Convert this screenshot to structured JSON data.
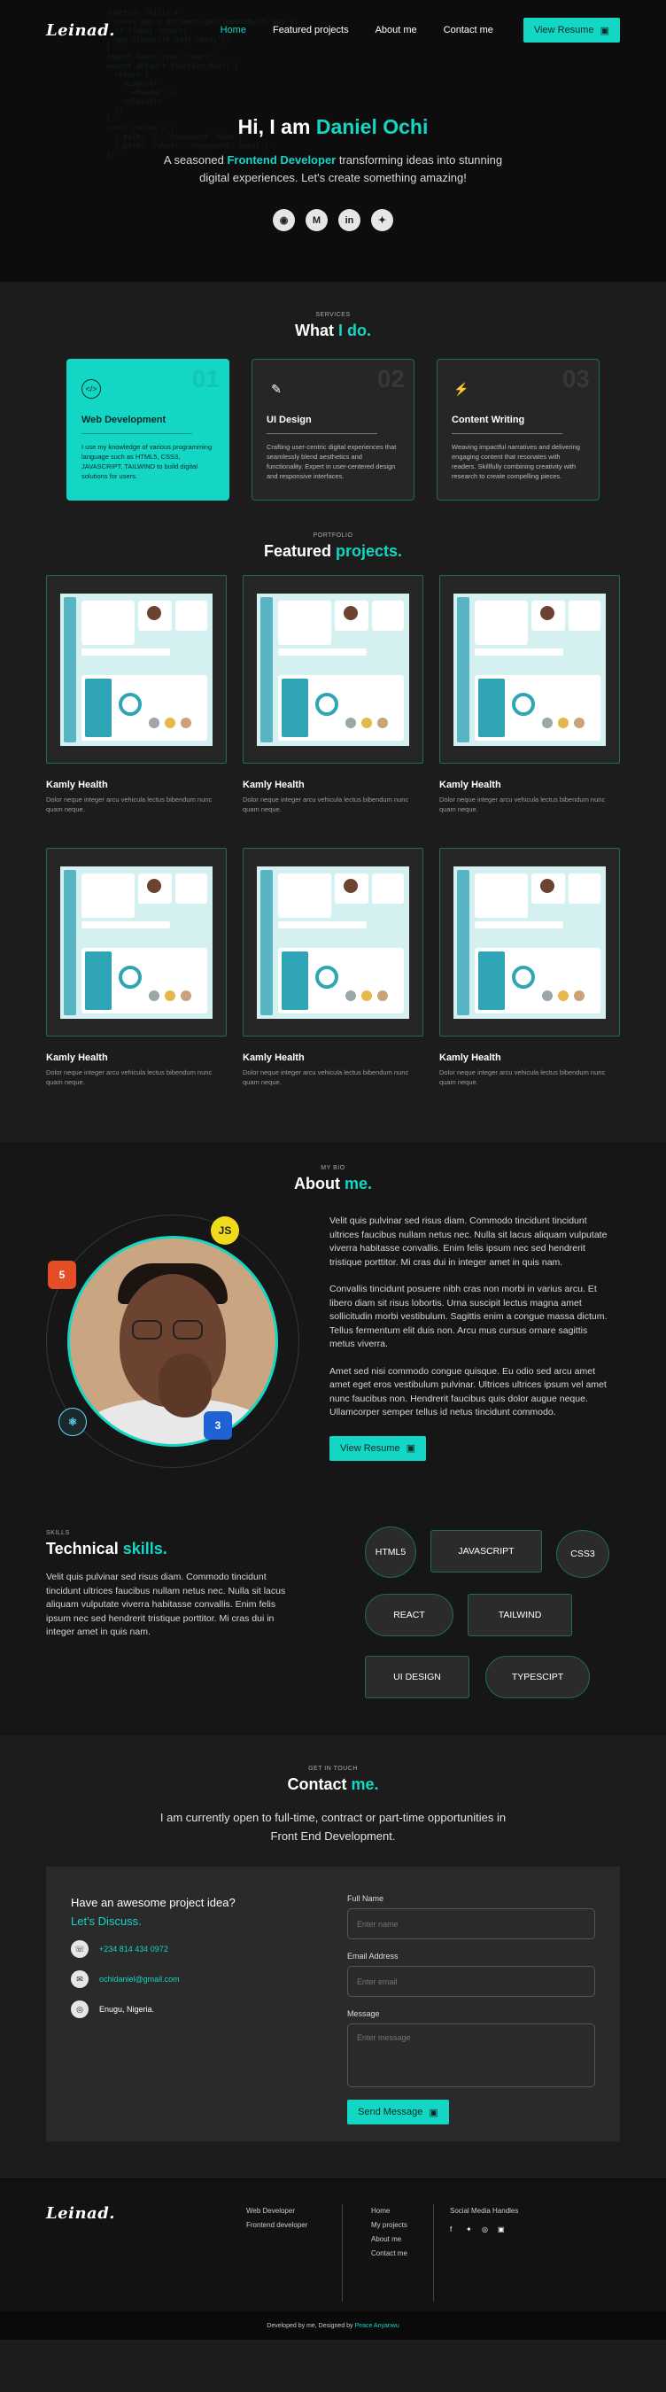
{
  "nav": {
    "logo": "Leinad.",
    "links": [
      "Home",
      "Featured projects",
      "About me",
      "Contact me"
    ],
    "resume_label": "View Resume"
  },
  "hero": {
    "greeting": "Hi, I am ",
    "name": "Daniel Ochi",
    "sub_pre": "A seasoned ",
    "role": "Frontend Developer",
    "sub_post": " transforming ideas into stunning",
    "sub_line2": "digital experiences. Let's create something amazing!",
    "socials": [
      "github-icon",
      "mail-icon",
      "linkedin-icon",
      "twitter-icon"
    ]
  },
  "services": {
    "label": "SERVICES",
    "title_pre": "What ",
    "title_accent": "I do",
    "items": [
      {
        "num": "01",
        "title": "Web Development",
        "desc": "I use my knowledge of various programming language such as HTML5, CSS3, JAVASCRIPT, TAILWIND to build digital solutions for users."
      },
      {
        "num": "02",
        "title": "UI Design",
        "desc": "Crafting user-centric digital experiences that seamlessly blend aesthetics and functionality. Expert in user-centered design and responsive interfaces."
      },
      {
        "num": "03",
        "title": "Content Writing",
        "desc": "Weaving impactful narratives and delivering engaging content that resonates with readers. Skillfully combining creativity with research to create compelling pieces."
      }
    ]
  },
  "projects": {
    "label": "PORTFOLIO",
    "title_pre": "Featured ",
    "title_accent": "projects",
    "items": [
      {
        "title": "Kamly Health",
        "desc": "Dolor neque integer arcu vehicula lectus bibendum nunc quam neque."
      },
      {
        "title": "Kamly Health",
        "desc": "Dolor neque integer arcu vehicula lectus bibendum nunc quam neque."
      },
      {
        "title": "Kamly Health",
        "desc": "Dolor neque integer arcu vehicula lectus bibendum nunc quam neque."
      },
      {
        "title": "Kamly Health",
        "desc": "Dolor neque integer arcu vehicula lectus bibendum nunc quam neque."
      },
      {
        "title": "Kamly Health",
        "desc": "Dolor neque integer arcu vehicula lectus bibendum nunc quam neque."
      },
      {
        "title": "Kamly Health",
        "desc": "Dolor neque integer arcu vehicula lectus bibendum nunc quam neque."
      }
    ]
  },
  "about": {
    "label": "MY BIO",
    "title_pre": "About ",
    "title_accent": "me",
    "paragraphs": [
      "Velit quis pulvinar sed risus diam. Commodo tincidunt tincidunt ultrices faucibus nullam netus nec. Nulla sit lacus aliquam vulputate viverra habitasse convallis. Enim felis ipsum nec sed hendrerit tristique porttitor. Mi cras dui in integer amet in quis nam.",
      "Convallis tincidunt posuere nibh cras non morbi in varius arcu. Et libero diam sit risus lobortis. Urna suscipit lectus magna amet sollicitudin morbi vestibulum. Sagittis enim a congue massa dictum. Tellus fermentum elit duis non. Arcu mus cursus ornare sagittis metus viverra.",
      "Amet sed nisi commodo congue quisque. Eu odio sed arcu amet amet eget eros vestibulum pulvinar. Ultrices ultrices ipsum vel amet nunc faucibus non. Hendrerit faucibus quis dolor augue neque. Ullamcorper semper tellus id netus tincidunt commodo."
    ],
    "resume_label": "View Resume",
    "badges": {
      "js": "JS",
      "html": "5",
      "css": "3",
      "react": "⚛"
    }
  },
  "skills": {
    "label": "SKILLS",
    "title_pre": "Technical ",
    "title_accent": "skills",
    "desc": "Velit quis pulvinar sed risus diam. Commodo tincidunt tincidunt ultrices faucibus nullam netus nec. Nulla sit lacus aliquam vulputate viverra habitasse convallis. Enim felis ipsum nec sed hendrerit tristique porttitor. Mi cras dui in integer amet in quis nam.",
    "items": [
      "HTML5",
      "JAVASCRIPT",
      "CSS3",
      "REACT",
      "TAILWIND",
      "UI DESIGN",
      "TYPESCIPT"
    ]
  },
  "contact": {
    "label": "GET IN TOUCH",
    "title_pre": "Contact ",
    "title_accent": "me",
    "sub1": "I am currently open to full-time, contract or part-time opportunities in",
    "sub2": "Front End Development.",
    "question": "Have an awesome project idea?",
    "discuss": "Let's Discuss.",
    "phone": "+234 814 434 0972",
    "email": "ochidaniel@gmail.com",
    "location": "Enugu, Nigeria.",
    "form": {
      "name_label": "Full Name",
      "name_ph": "Enter name",
      "email_label": "Email Address",
      "email_ph": "Enter email",
      "msg_label": "Message",
      "msg_ph": "Enter message",
      "submit": "Send Message"
    }
  },
  "footer": {
    "logo": "Leinad.",
    "roles": [
      "Web Developer",
      "Frontend developer"
    ],
    "links": [
      "Home",
      "My projects",
      "About me",
      "Contact me"
    ],
    "social_title": "Social Media Handles",
    "bottom_pre": "Developed by me, Designed by ",
    "bottom_link": "Peace Anyanwu"
  },
  "colors": {
    "accent": "#14d6c4",
    "bg": "#1c1c1c"
  }
}
